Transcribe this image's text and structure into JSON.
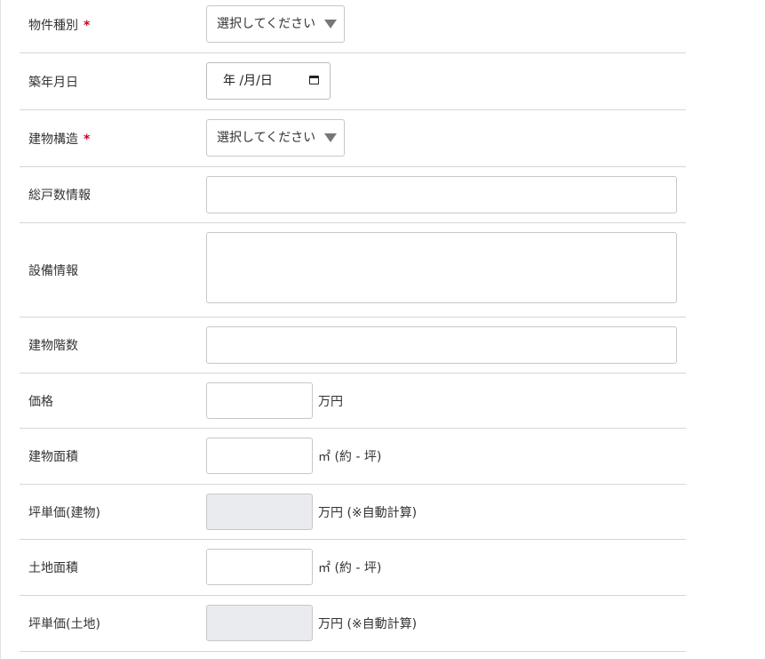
{
  "form": {
    "property_type": {
      "label": "物件種別",
      "required_mark": "*",
      "select_value": "選択してください"
    },
    "built_date": {
      "label": "築年月日",
      "date_value": "年 /月/日"
    },
    "structure": {
      "label": "建物構造",
      "required_mark": "*",
      "select_value": "選択してください"
    },
    "total_units": {
      "label": "総戸数情報",
      "value": ""
    },
    "facilities": {
      "label": "設備情報",
      "value": ""
    },
    "floors": {
      "label": "建物階数",
      "value": ""
    },
    "price": {
      "label": "価格",
      "value": "",
      "unit": "万円"
    },
    "building_area": {
      "label": "建物面積",
      "value": "",
      "unit": "㎡ (約 - 坪)"
    },
    "unit_price_building": {
      "label": "坪単価(建物)",
      "value": "",
      "unit": "万円 (※自動計算)"
    },
    "land_area": {
      "label": "土地面積",
      "value": "",
      "unit": "㎡ (約 - 坪)"
    },
    "unit_price_land": {
      "label": "坪単価(土地)",
      "value": "",
      "unit": "万円 (※自動計算)"
    }
  }
}
